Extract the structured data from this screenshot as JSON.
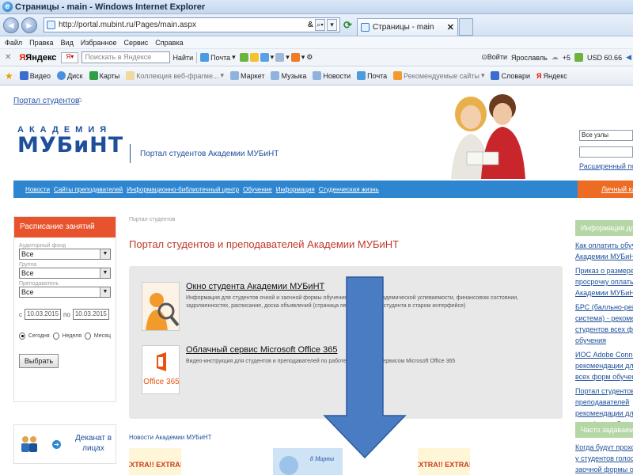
{
  "browser": {
    "title": "Страницы - main - Windows Internet Explorer",
    "url": "http://portal.mubint.ru/Pages/main.aspx",
    "tab_title": "Страницы - main",
    "menu": [
      "Файл",
      "Правка",
      "Вид",
      "Избранное",
      "Сервис",
      "Справка"
    ],
    "yandex": {
      "logo": "Яндекс",
      "search_placeholder": "Поискать в Яндексе",
      "find_label": "Найти",
      "mail_label": "Почта",
      "login_label": "Войти",
      "city_label": "Ярославль",
      "temp_label": "+5",
      "usd_label": "USD 60.66"
    },
    "favorites": [
      "Видео",
      "Диск",
      "Карты",
      "Коллекция веб-фрагме...",
      "Маркет",
      "Музыка",
      "Новости",
      "Почта",
      "Рекомендуемые сайты",
      "Словари",
      "Яндекс"
    ]
  },
  "site": {
    "top_link": "Портал студентов",
    "logo_small": "АКАДЕМИЯ",
    "logo_big": "МУБиНТ",
    "portal_title": "Портал студентов Академии МУБиНТ",
    "search_scope": "Все узлы",
    "advanced_search": "Расширенный поиск",
    "nav": [
      "Новости",
      "Сайты преподавателей",
      "Информационно-библиотечный центр",
      "Обучение",
      "Информация",
      "Студенческая жизнь"
    ],
    "cabinet": "Личный кабинет"
  },
  "schedule": {
    "title": "Расписание занятий",
    "fund_label": "Аудиторный фонд",
    "fund_value": "Все",
    "group_label": "Группа",
    "group_value": "Все",
    "teacher_label": "Преподаватель",
    "teacher_value": "Все",
    "from_label": "с",
    "from_value": "10.03.2015",
    "to_label": "по",
    "to_value": "10.03.2015",
    "radio_today": "Сегодня",
    "radio_week": "Неделя",
    "radio_month": "Месяц",
    "choose_button": "Выбрать"
  },
  "dekanat": "Деканат в лицах",
  "main": {
    "crumb": "Портал студентов",
    "title": "Портал студентов и преподавателей Академии МУБиНТ",
    "service1_title": "Окно студента Академии МУБиНТ",
    "service1_desc": "Информация для студентов очной и заочной формы обучения о текущей академической успеваемости, финансовом состоянии, задолженностях, расписание, доска объявлений (страница перехода в окно студента в старом интерфейсе)",
    "service2_title": "Облачный сервис Microsoft Office 365",
    "service2_desc": "Видео-инструкция для студентов и преподавателей по работе с облачным сервисом Microsoft Office 365",
    "service2_logo": "Office 365",
    "news_title": "Новости Академии МУБиНТ",
    "news_badge": "EXTRA!! EXTRA!!",
    "news_march": "8 Марта"
  },
  "right": {
    "info_head": "Информация для студентов",
    "info_links": [
      "Как оплатить обучение",
      "Академии МУБиНТ",
      "",
      "Приказ о размере пени",
      "просрочку оплаты",
      "Академии МУБиНТ",
      "",
      "БРС (балльно-рейтинговая",
      "система) - рекомендации",
      "студентов всех форм",
      "обучения",
      "",
      "ИОС Adobe Connect",
      "рекомендации для",
      "всех форм обучения",
      "",
      "Портал студентов",
      "преподавателей",
      "рекомендации для",
      "всех форм обучения"
    ],
    "faq_head": "Часто задаваемые вопросы",
    "faq_links": [
      "Когда будут проходить",
      "у студентов голосования",
      "заочной формы обучения"
    ]
  },
  "colors": {
    "brand_blue": "#1e4f9b",
    "nav_blue": "#2e86d0",
    "accent_orange": "#ee6b23",
    "schedule_red": "#e8532e",
    "info_green": "#b5d7a6",
    "arrow_blue": "#4a7cc4"
  }
}
